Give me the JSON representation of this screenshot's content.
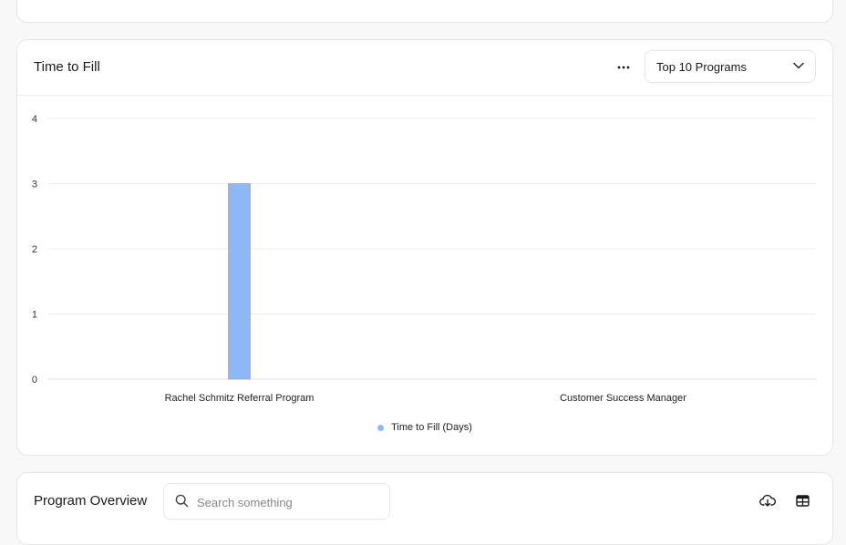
{
  "chart_card": {
    "title": "Time to Fill",
    "dropdown_value": "Top 10 Programs"
  },
  "chart_data": {
    "type": "bar",
    "categories": [
      "Rachel Schmitz Referral Program",
      "Customer Success Manager"
    ],
    "series": [
      {
        "name": "Time to Fill (Days)",
        "values": [
          3,
          0
        ]
      }
    ],
    "yticks": [
      "0",
      "1",
      "2",
      "3",
      "4"
    ],
    "ylim": [
      0,
      4
    ],
    "grid": true,
    "legend_position": "bottom-center",
    "bar_color": "#8db8f5"
  },
  "overview_card": {
    "title": "Program Overview",
    "search_placeholder": "Search something"
  },
  "icons": {
    "more": "more-horizontal-icon",
    "chevron": "chevron-down-icon",
    "search": "search-icon",
    "download": "cloud-download-icon",
    "table": "table-icon"
  }
}
